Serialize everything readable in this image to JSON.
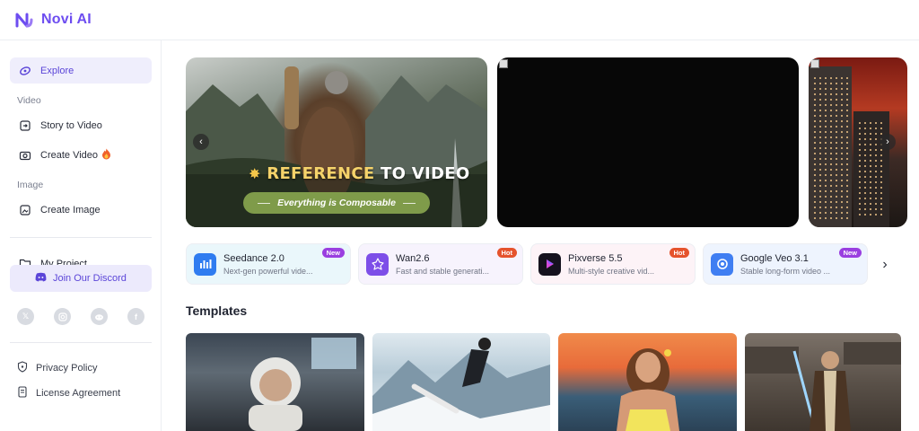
{
  "brand": {
    "name": "Novi AI",
    "accent": "#6d4df0"
  },
  "sidebar": {
    "explore": "Explore",
    "sections": {
      "video": "Video",
      "image": "Image"
    },
    "items": {
      "story_to_video": "Story to Video",
      "create_video": "Create Video",
      "create_image": "Create Image"
    },
    "my_project": "My Project",
    "discord": "Join Our Discord",
    "socials": [
      "x-icon",
      "instagram-icon",
      "reddit-icon",
      "facebook-icon"
    ],
    "privacy": "Privacy Policy",
    "license": "License Agreement"
  },
  "banner": {
    "title_highlight": "REFERENCE",
    "title_rest": " TO VIDEO",
    "pill": "Everything is Composable"
  },
  "models": [
    {
      "name": "Seedance 2.0",
      "desc": "Next-gen powerful vide...",
      "badge": "New",
      "color": "#2f7cf0",
      "bg": "#eaf7fb"
    },
    {
      "name": "Wan2.6",
      "desc": "Fast and stable generati...",
      "badge": "Hot",
      "color": "#7d4ee8",
      "bg": "#f7f3fd"
    },
    {
      "name": "Pixverse 5.5",
      "desc": "Multi-style creative vid...",
      "badge": "Hot",
      "color": "#15121e",
      "bg": "#fdf3f7"
    },
    {
      "name": "Google Veo 3.1",
      "desc": "Stable long-form video ...",
      "badge": "New",
      "color": "#3f7ef2",
      "bg": "#eef4fe"
    }
  ],
  "templates_title": "Templates"
}
